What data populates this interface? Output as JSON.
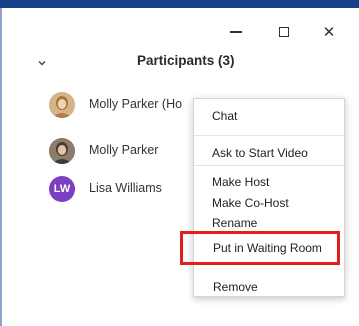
{
  "window": {
    "controls": [
      "minimize",
      "maximize",
      "close"
    ],
    "close_glyph": "✕"
  },
  "panel": {
    "title": "Participants (3)",
    "collapse_icon": "chevron-down-icon"
  },
  "participants": [
    {
      "name": "Molly Parker (Ho",
      "avatar": "photo"
    },
    {
      "name": "Molly Parker",
      "avatar": "photo"
    },
    {
      "name": "Lisa Williams",
      "avatar": "LW"
    }
  ],
  "context_menu": {
    "items": [
      "Chat",
      "Ask to Start Video",
      "Make Host",
      "Make Co-Host",
      "Rename",
      "Put in Waiting Room",
      "Remove"
    ],
    "highlighted_item": "Put in Waiting Room",
    "highlight_color": "#e02020"
  },
  "colors": {
    "title_bar": "#17408b",
    "lw_avatar": "#7a3fc2"
  }
}
